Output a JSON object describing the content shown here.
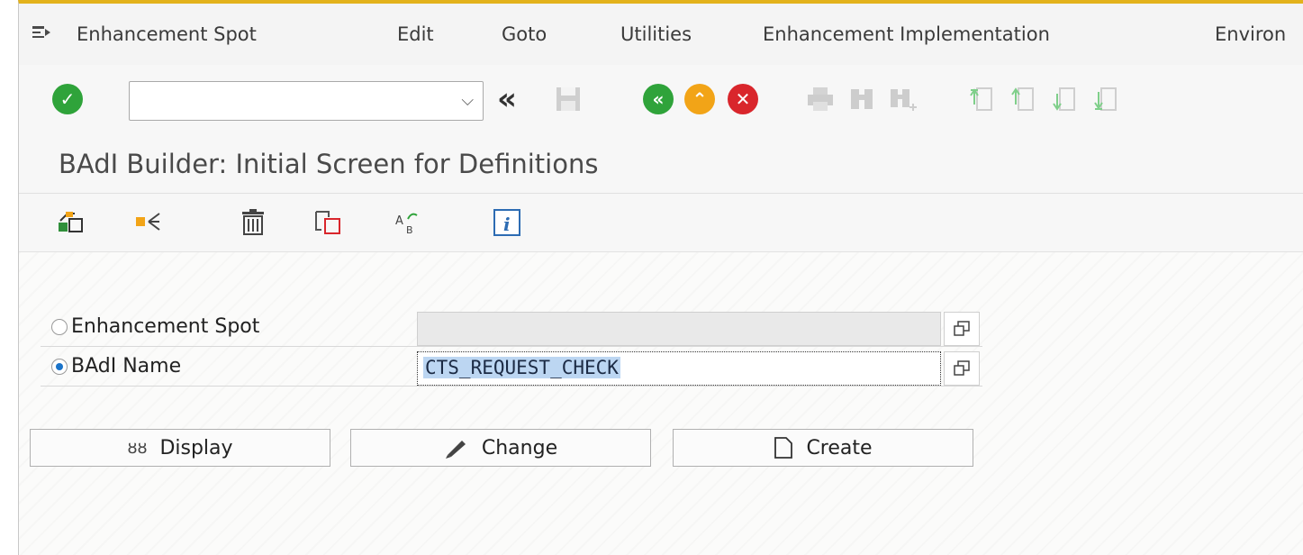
{
  "menu": {
    "items": [
      {
        "label": "Enhancement Spot"
      },
      {
        "label": "Edit"
      },
      {
        "label": "Goto"
      },
      {
        "label": "Utilities"
      },
      {
        "label": "Enhancement Implementation"
      },
      {
        "label": "Environ"
      }
    ]
  },
  "toolbar": {
    "command_value": "",
    "icons": [
      "enter-icon",
      "command-field",
      "back-chevrons-icon",
      "save-icon",
      "back-icon",
      "exit-icon",
      "cancel-icon",
      "print-icon",
      "find-icon",
      "find-next-icon",
      "first-page-icon",
      "previous-page-icon",
      "next-page-icon",
      "last-page-icon"
    ]
  },
  "title": "BAdI Builder: Initial Screen for Definitions",
  "app_toolbar": {
    "icons": [
      "other-object-icon",
      "where-used-icon",
      "delete-icon",
      "copy-icon",
      "rename-icon",
      "info-icon"
    ]
  },
  "form": {
    "enhancement_spot": {
      "label": "Enhancement Spot",
      "value": "",
      "selected": false
    },
    "badi_name": {
      "label": "BAdI Name",
      "value": "CTS_REQUEST_CHECK",
      "selected": true
    }
  },
  "buttons": {
    "display": "Display",
    "change": "Change",
    "create": "Create"
  },
  "colors": {
    "accent": "#e3b21c",
    "green": "#2fa33a",
    "orange": "#f2a417",
    "red": "#d9262c",
    "selection": "#bcd6f2"
  }
}
